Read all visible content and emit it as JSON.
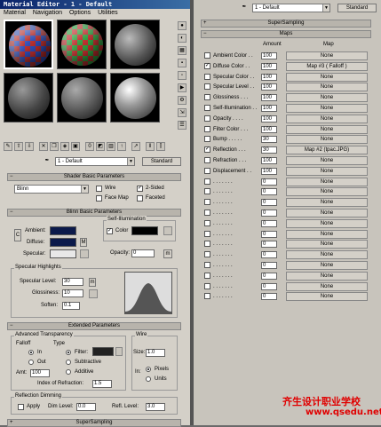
{
  "left": {
    "title": "Material Editor - 1 - Default",
    "menu": [
      "Material",
      "Navigation",
      "Options",
      "Utilities"
    ],
    "material_name": "1 - Default",
    "standard_button": "Standard",
    "shader_rollup": "Shader Basic Parameters",
    "shader_type": "Blinn",
    "wire": "Wire",
    "two_sided": "2-Sided",
    "face_map": "Face Map",
    "faceted": "Faceted",
    "blinn_rollup": "Blinn Basic Parameters",
    "self_illum_group": "Self-Illumination",
    "self_illum_color": "Color",
    "ambient": "Ambient:",
    "diffuse": "Diffuse:",
    "specular": "Specular:",
    "opacity_label": "Opacity:",
    "opacity_value": "0",
    "lock_c": "C",
    "map_m": "M",
    "m_btn": "m",
    "spec_group": "Specular Highlights",
    "spec_level": "Specular Level:",
    "spec_level_value": "30",
    "glossiness": "Glossiness:",
    "glossiness_value": "10",
    "soften": "Soften:",
    "soften_value": "0.1",
    "extended_rollup": "Extended Parameters",
    "adv_transparency": "Advanced Transparency",
    "falloff": "Falloff",
    "type": "Type",
    "in": "In",
    "out": "Out",
    "amt": "Amt:",
    "amt_value": "100",
    "filter": "Filter:",
    "subtractive": "Subtractive",
    "additive": "Additive",
    "index_of_refraction": "Index of Refraction:",
    "ior_value": "1.5",
    "wire_group": "Wire",
    "size": "Size:",
    "size_value": "1.0",
    "in_label": "In:",
    "pixels": "Pixels",
    "units": "Units",
    "reflection_dimming": "Reflection Dimming",
    "apply": "Apply",
    "dim_level": "Dim Level:",
    "dim_level_value": "0.0",
    "refl_level": "Refl. Level:",
    "refl_level_value": "3.0",
    "bottom_rollup": "SuperSampling"
  },
  "right": {
    "material_name": "1 - Default",
    "standard_button": "Standard",
    "supersampling_rollup": "SuperSampling",
    "maps_rollup": "Maps",
    "col_amount": "Amount",
    "col_map": "Map",
    "rows": [
      {
        "name": "Ambient Color . .",
        "amount": "100",
        "map": "None",
        "checked": false
      },
      {
        "name": "Diffuse Color . .",
        "amount": "100",
        "map": "Map #3 ( Falloff )",
        "checked": true
      },
      {
        "name": "Specular Color . .",
        "amount": "100",
        "map": "None",
        "checked": false
      },
      {
        "name": "Specular Level . .",
        "amount": "100",
        "map": "None",
        "checked": false
      },
      {
        "name": "Glossiness . . .",
        "amount": "100",
        "map": "None",
        "checked": false
      },
      {
        "name": "Self-Illumination . .",
        "amount": "100",
        "map": "None",
        "checked": false
      },
      {
        "name": "Opacity . . . .",
        "amount": "100",
        "map": "None",
        "checked": false
      },
      {
        "name": "Filter Color . . .",
        "amount": "100",
        "map": "None",
        "checked": false
      },
      {
        "name": "Bump . . . . .",
        "amount": "30",
        "map": "None",
        "checked": false
      },
      {
        "name": "Reflection . . .",
        "amount": "30",
        "map": "Map #2 (tpac.JPG)",
        "checked": true
      },
      {
        "name": "Refraction . . .",
        "amount": "100",
        "map": "None",
        "checked": false
      },
      {
        "name": "Displacement . .",
        "amount": "100",
        "map": "None",
        "checked": false
      },
      {
        "name": ". . . . . . .",
        "amount": "0",
        "map": "None",
        "checked": false
      },
      {
        "name": ". . . . . . .",
        "amount": "0",
        "map": "None",
        "checked": false
      },
      {
        "name": ". . . . . . .",
        "amount": "0",
        "map": "None",
        "checked": false
      },
      {
        "name": ". . . . . . .",
        "amount": "0",
        "map": "None",
        "checked": false
      },
      {
        "name": ". . . . . . .",
        "amount": "0",
        "map": "None",
        "checked": false
      },
      {
        "name": ". . . . . . .",
        "amount": "0",
        "map": "None",
        "checked": false
      },
      {
        "name": ". . . . . . .",
        "amount": "0",
        "map": "None",
        "checked": false
      },
      {
        "name": ". . . . . . .",
        "amount": "0",
        "map": "None",
        "checked": false
      },
      {
        "name": ". . . . . . .",
        "amount": "0",
        "map": "None",
        "checked": false
      },
      {
        "name": ". . . . . . .",
        "amount": "0",
        "map": "None",
        "checked": false
      },
      {
        "name": ". . . . . . .",
        "amount": "0",
        "map": "None",
        "checked": false
      },
      {
        "name": ". . . . . . .",
        "amount": "0",
        "map": "None",
        "checked": false
      }
    ]
  },
  "watermark": {
    "line1": "齐生设计职业学校",
    "line2": "www.qsedu.net"
  },
  "colors": {
    "ambient": "#0c1a4a",
    "diffuse": "#0c1a4a",
    "specular": "#e8e8e8",
    "self_illum": "#000000",
    "filter": "#222222",
    "title": "#0a246a",
    "watermark": "#e00000"
  }
}
